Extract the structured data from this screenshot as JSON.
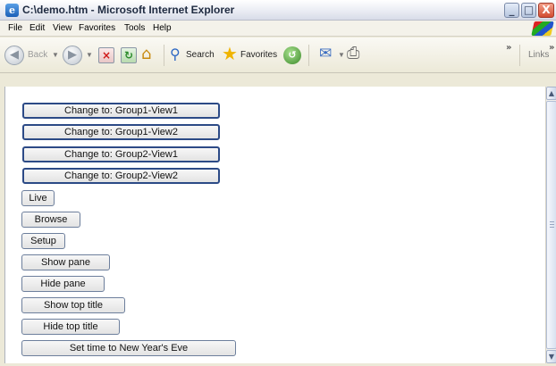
{
  "window": {
    "title": "C:\\demo.htm - Microsoft Internet Explorer",
    "app_icon_glyph": "e",
    "minimize_glyph": "_",
    "maximize_glyph": "□",
    "close_glyph": "X"
  },
  "menu": [
    "File",
    "Edit",
    "View",
    "Favorites",
    "Tools",
    "Help"
  ],
  "toolbar": {
    "back_label": "Back",
    "search_label": "Search",
    "favorites_label": "Favorites",
    "links_label": "Links",
    "chevron": "»",
    "icons": [
      "back-icon",
      "forward-icon",
      "stop-icon",
      "refresh-icon",
      "home-icon",
      "search-icon",
      "favorites-star-icon",
      "history-icon",
      "mail-icon",
      "print-icon"
    ]
  },
  "page_buttons": [
    "Change to: Group1-View1",
    "Change to: Group1-View2",
    "Change to: Group2-View1",
    "Change to: Group2-View2",
    "Live",
    "Browse",
    "Setup",
    "Show pane",
    "Hide pane",
    "Show top title",
    "Hide top title",
    "Set time to New Year's Eve"
  ],
  "scrollbar": {
    "up_glyph": "▲",
    "down_glyph": "▼"
  }
}
